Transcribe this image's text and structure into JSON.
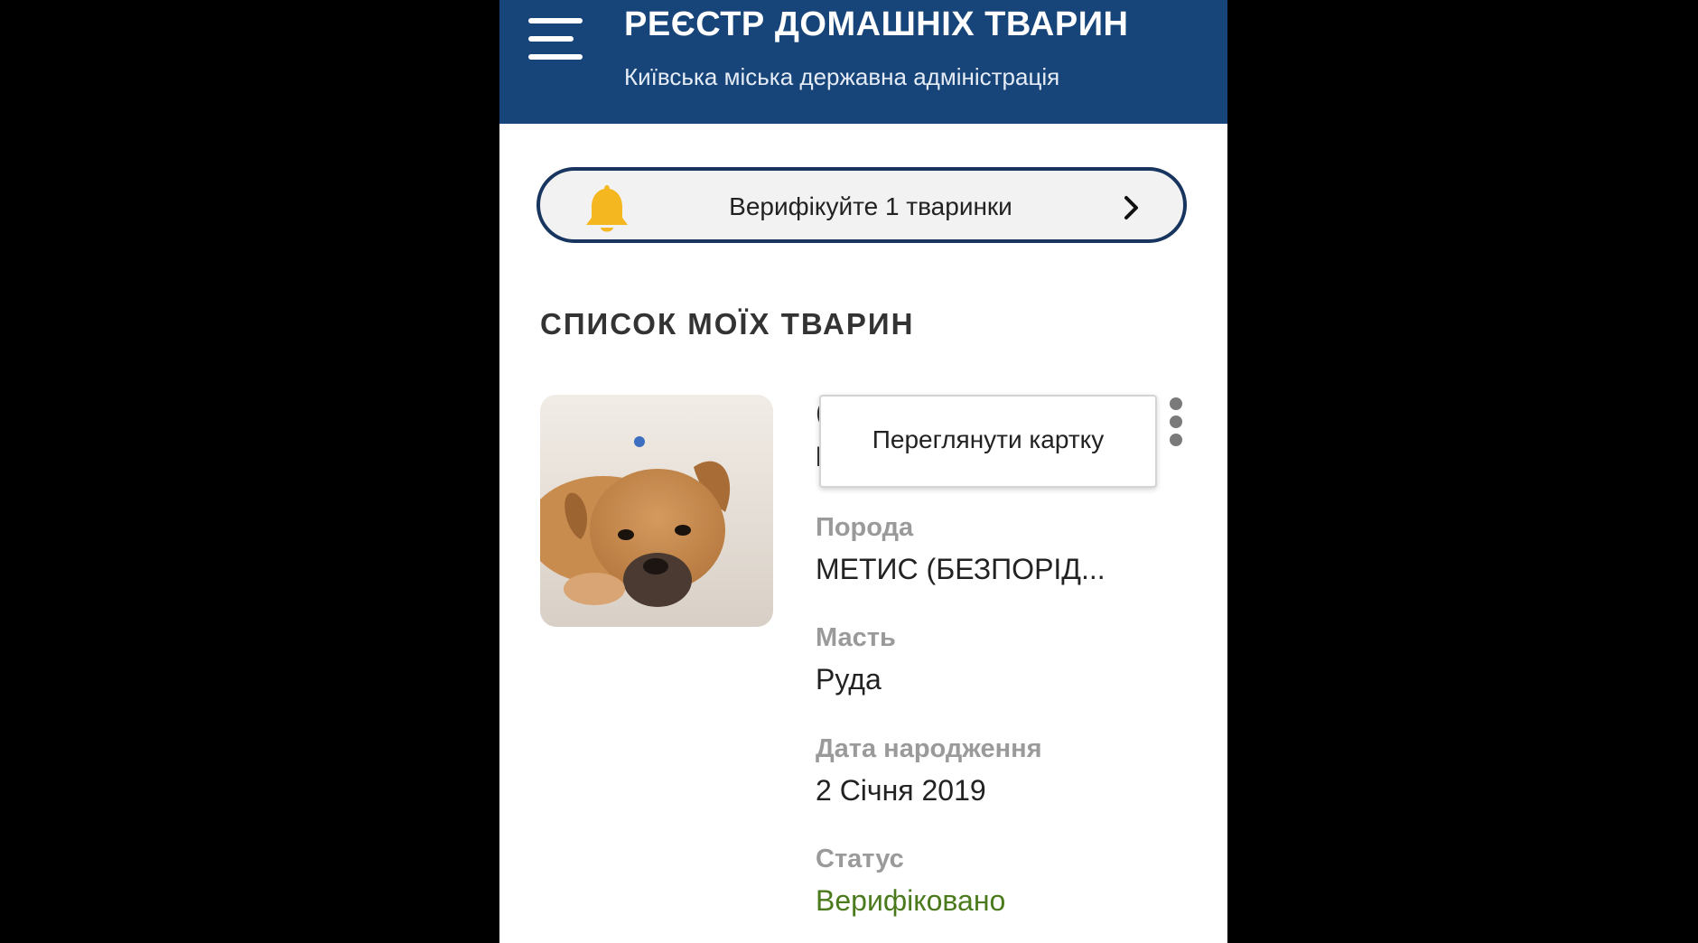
{
  "header": {
    "title": "РЕЄСТР ДОМАШНІХ ТВАРИН",
    "subtitle": "Київська міська державна адміністрація",
    "menu_icon": "hamburger-menu-icon"
  },
  "banner": {
    "text": "Верифікуйте 1 тваринки",
    "icon": "bell-icon",
    "accent_color": "#f5b720",
    "border_color": "#17355e"
  },
  "section": {
    "title": "СПИСОК МОЇХ ТВАРИН"
  },
  "pet": {
    "photo": "dog-puppy-photo",
    "partial_field_label": "(",
    "partial_field_value": "l",
    "fields": [
      {
        "label": "Порода",
        "value": "МЕТИС (БЕЗПОРІД..."
      },
      {
        "label": "Масть",
        "value": "Руда"
      },
      {
        "label": "Дата народження",
        "value": "2 Січня 2019"
      },
      {
        "label": "Статус",
        "value": "Верифіковано"
      }
    ],
    "status_color": "#4b7a1d"
  },
  "context_menu": {
    "items": [
      "Переглянути картку"
    ]
  },
  "colors": {
    "header_bg": "#17457a",
    "background": "#ffffff"
  }
}
